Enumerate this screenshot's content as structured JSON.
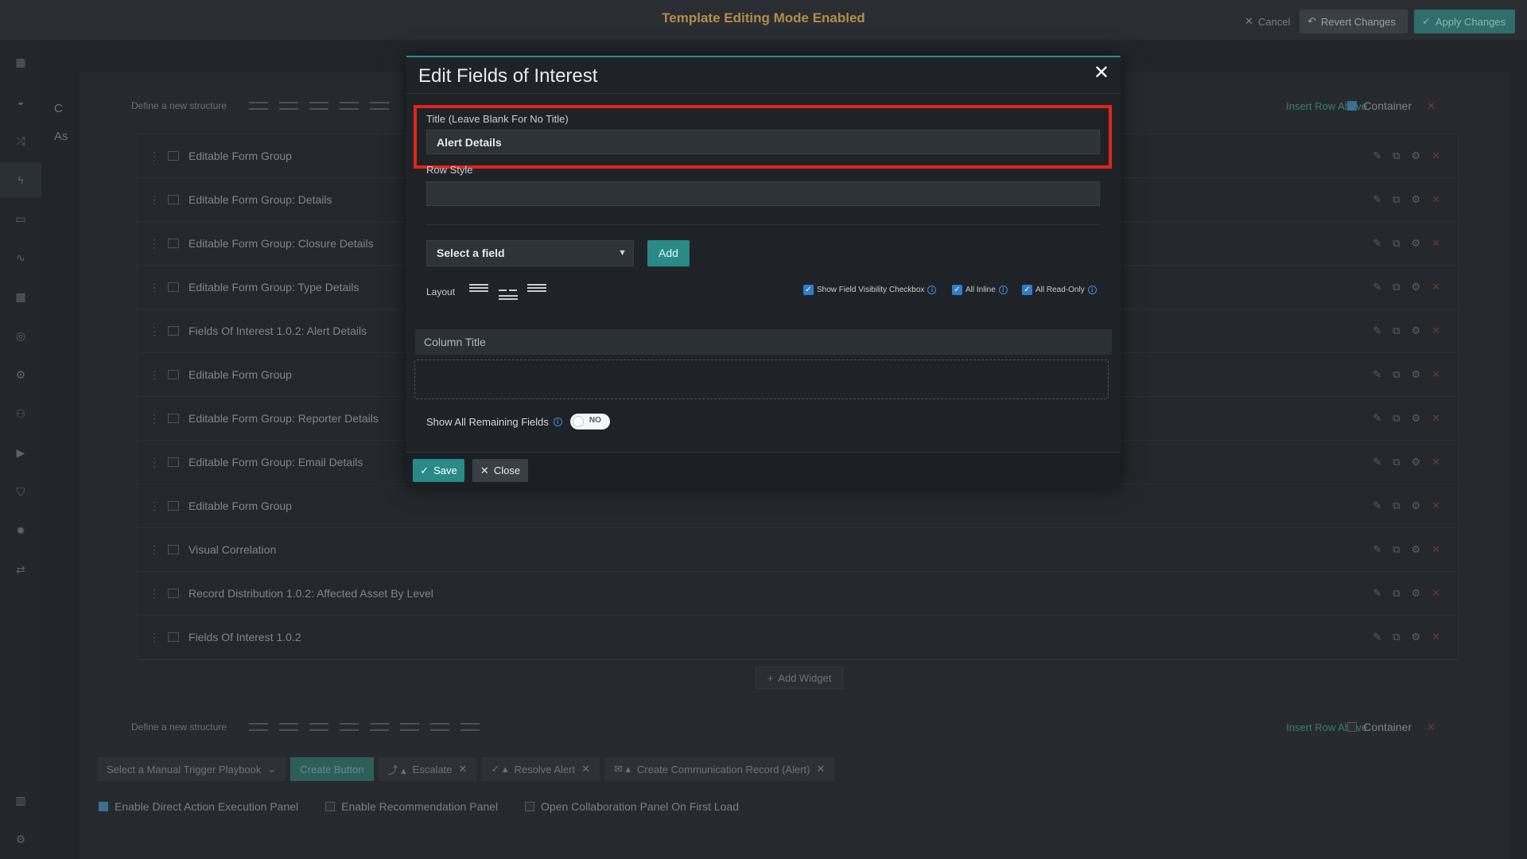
{
  "topbar": {
    "title": "Template Editing Mode Enabled",
    "cancel_label": "Cancel",
    "revert_label": "Revert Changes",
    "apply_label": "Apply Changes"
  },
  "page": {
    "strip_letters": [
      "C",
      "As"
    ],
    "struct_label": "Define a new structure",
    "insert_row_label": "Insert Row Above",
    "container_label": "Container",
    "widgets": [
      "Editable Form Group",
      "Editable Form Group: Details",
      "Editable Form Group: Closure Details",
      "Editable Form Group: Type Details",
      "Fields Of Interest 1.0.2: Alert Details",
      "Editable Form Group",
      "Editable Form Group: Reporter Details",
      "Editable Form Group: Email Details",
      "Editable Form Group",
      "Visual Correlation",
      "Record Distribution 1.0.2: Affected Asset By Level",
      "Fields Of Interest 1.0.2"
    ],
    "add_widget_label": "Add Widget",
    "action_bar": {
      "playbook_select": "Select a Manual Trigger Playbook",
      "create_button": "Create Button",
      "escalate": "Escalate",
      "resolve": "Resolve Alert",
      "communication": "Create Communication Record (Alert)"
    },
    "options": {
      "direct_action": "Enable Direct Action Execution Panel",
      "recommendation": "Enable Recommendation Panel",
      "collaboration": "Open Collaboration Panel On First Load"
    }
  },
  "modal": {
    "title": "Edit Fields of Interest",
    "title_field_label": "Title (Leave Blank For No Title)",
    "title_field_value": "Alert Details",
    "row_style_label": "Row Style",
    "row_style_value": "",
    "select_field": "Select a field",
    "add_label": "Add",
    "layout_label": "Layout",
    "show_visibility_label": "Show Field Visibility Checkbox",
    "all_inline_label": "All Inline",
    "all_readonly_label": "All Read-Only",
    "column_title": "Column Title",
    "show_remaining_label": "Show All Remaining Fields",
    "toggle_state": "NO",
    "save_label": "Save",
    "close_label": "Close"
  },
  "colors": {
    "accent": "#2a8a86",
    "highlight": "#e0251b",
    "checkbox": "#2f7fc8",
    "warning_title": "#b08d4a"
  }
}
